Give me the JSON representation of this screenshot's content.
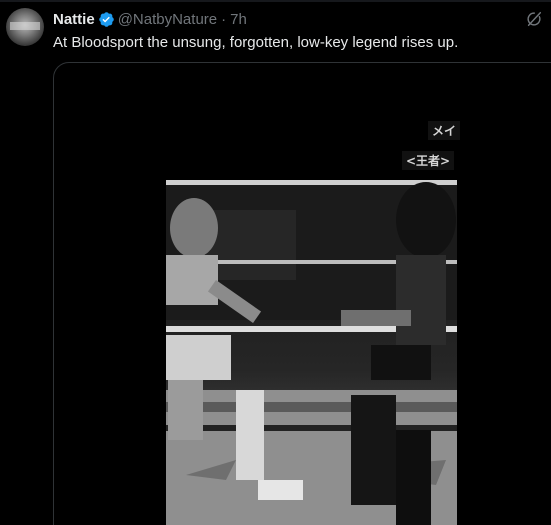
{
  "tweet": {
    "author_name": "Nattie",
    "handle": "@NatbyNature",
    "separator": "·",
    "time": "7h",
    "text": "At Bloodsport the unsung, forgotten, low-key legend rises up."
  },
  "media": {
    "overlay_top": "メイ",
    "overlay_mid": "<王者>"
  },
  "colors": {
    "verified": "#1d9bf0",
    "text_primary": "#e7e9ea",
    "text_secondary": "#71767b",
    "border": "#2f3336"
  },
  "icons": {
    "verified": "verified-badge-icon",
    "more": "grok-icon"
  }
}
